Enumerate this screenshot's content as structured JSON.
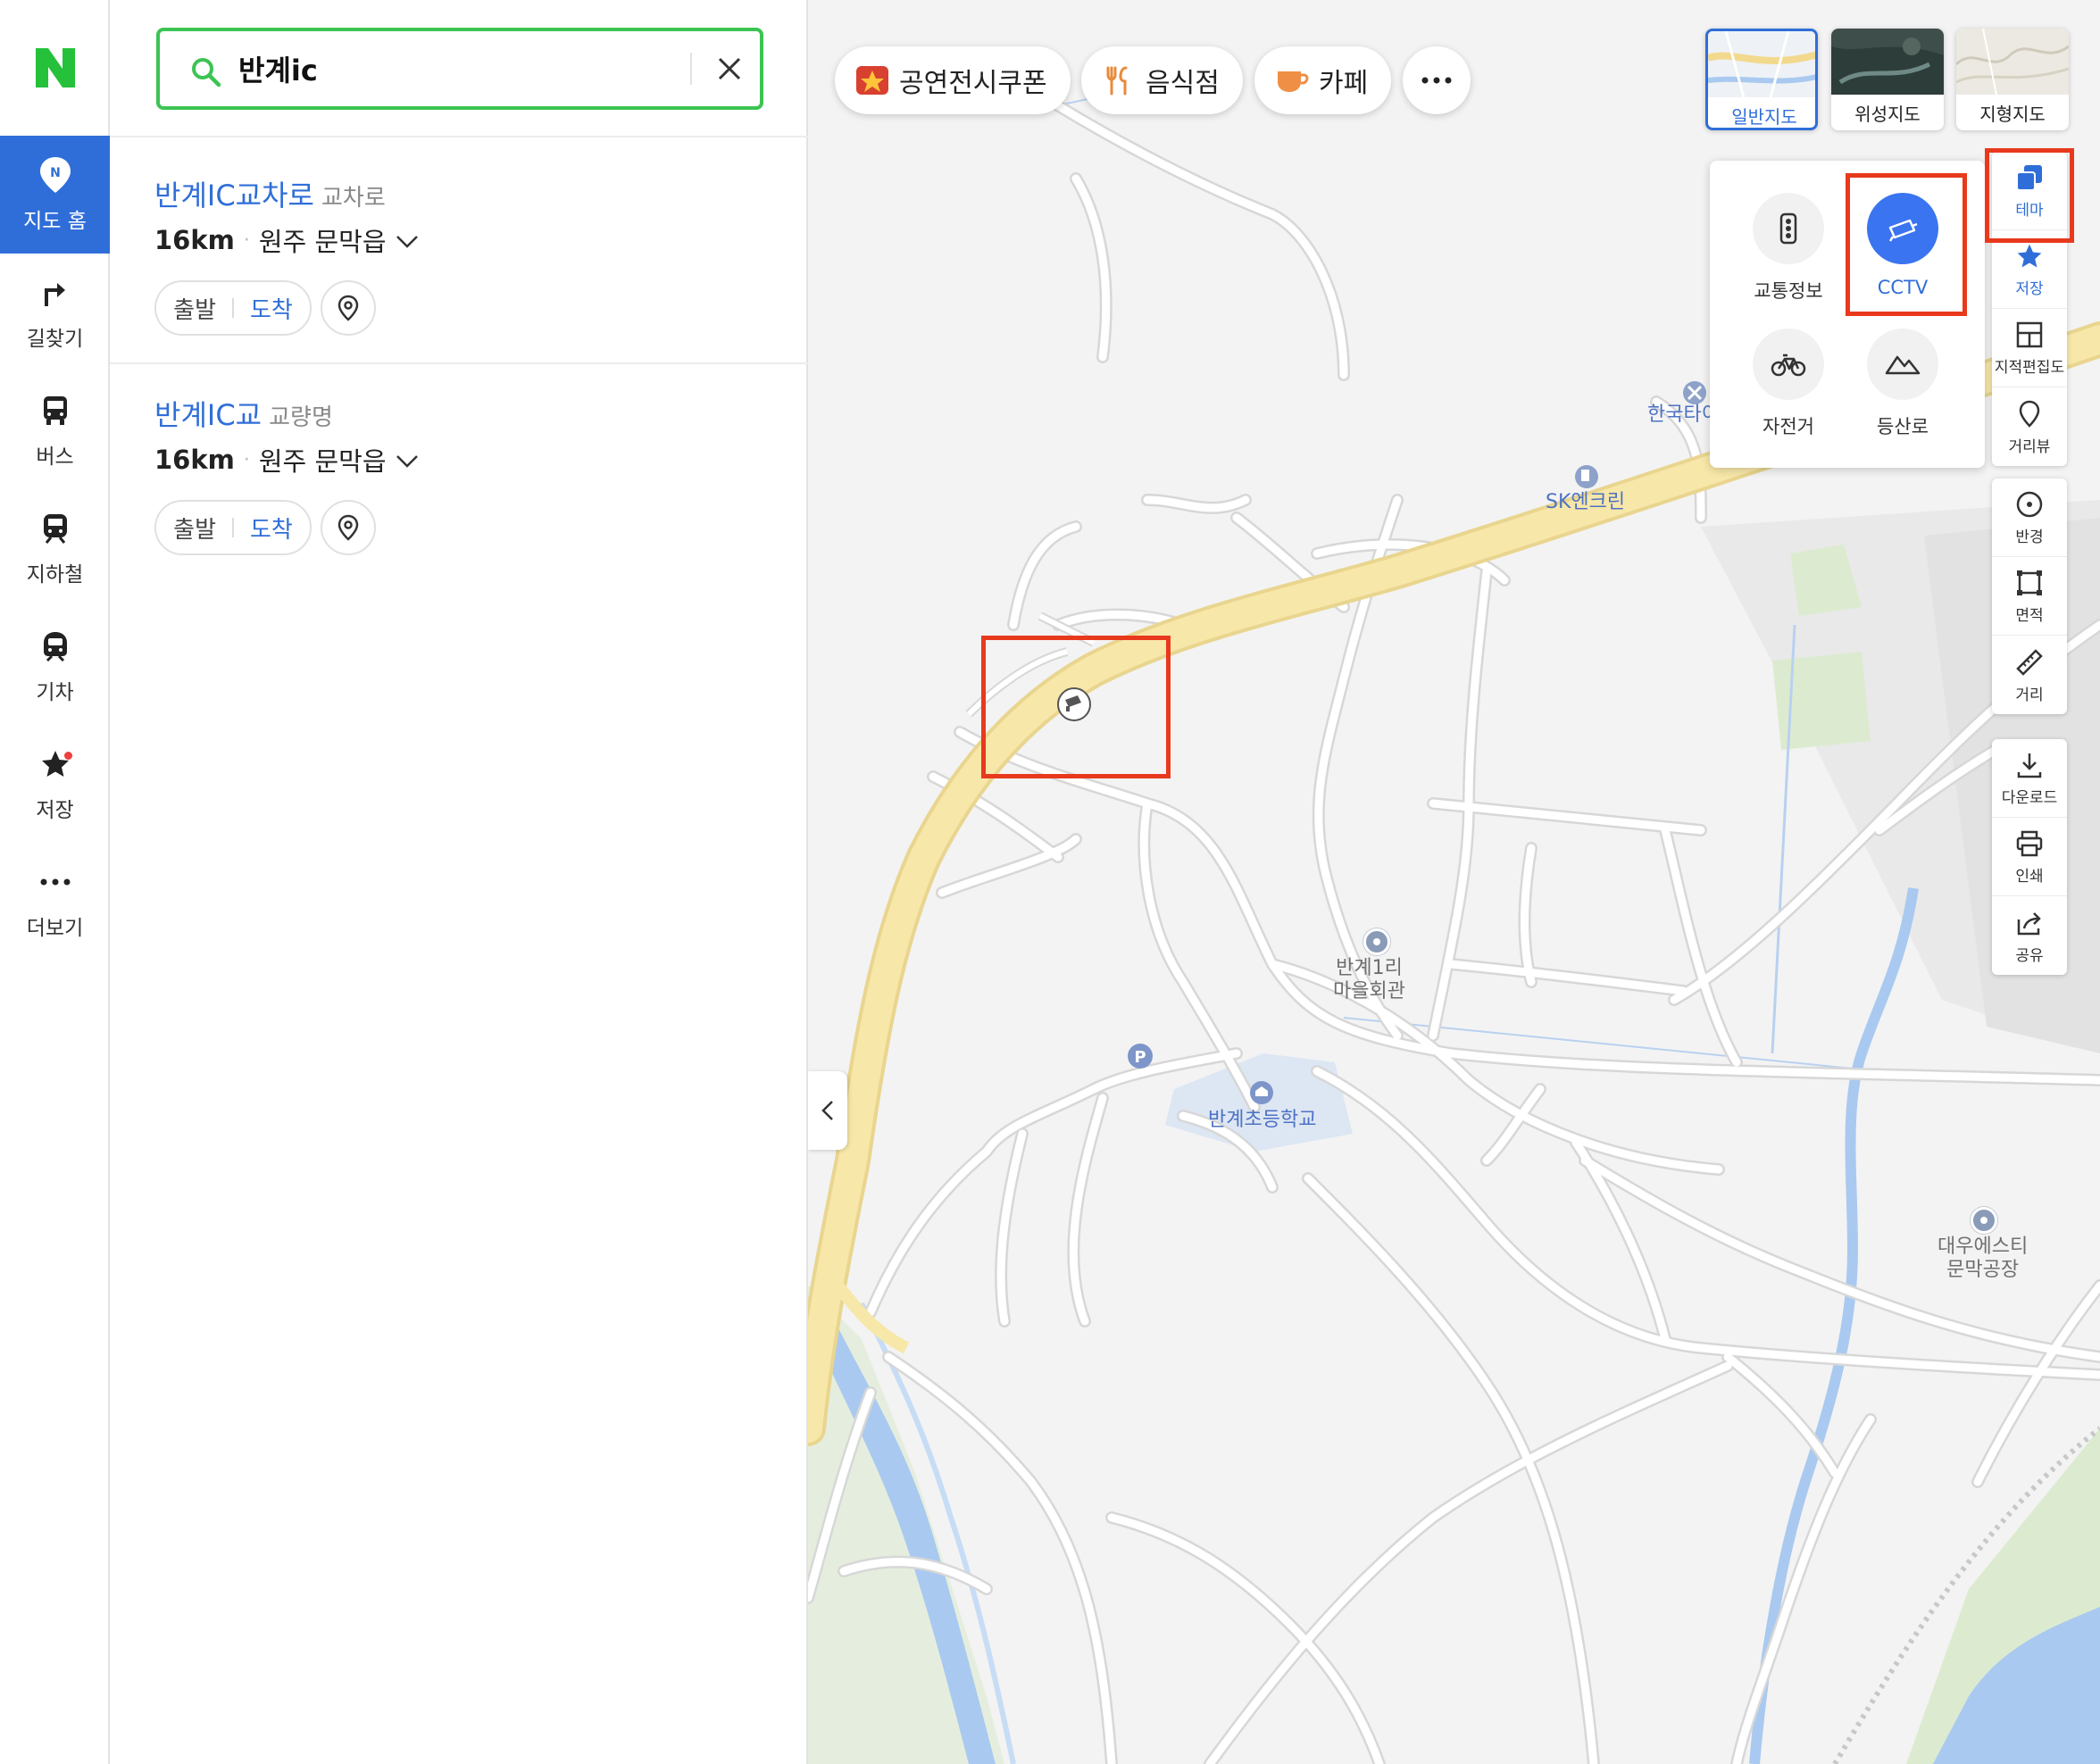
{
  "rail": {
    "items": [
      {
        "label": "지도 홈",
        "icon": "map-home-pin-icon",
        "active": true
      },
      {
        "label": "길찾기",
        "icon": "directions-arrow-icon"
      },
      {
        "label": "버스",
        "icon": "bus-icon"
      },
      {
        "label": "지하철",
        "icon": "subway-icon"
      },
      {
        "label": "기차",
        "icon": "train-icon"
      },
      {
        "label": "저장",
        "icon": "star-icon"
      },
      {
        "label": "더보기",
        "icon": "more-dots-icon"
      }
    ]
  },
  "search": {
    "query": "반계ic"
  },
  "results": [
    {
      "name": "반계IC교차로",
      "category": "교차로",
      "distance": "16km",
      "address": "원주 문막읍",
      "start_label": "출발",
      "arrive_label": "도착"
    },
    {
      "name": "반계IC교",
      "category": "교량명",
      "distance": "16km",
      "address": "원주 문막읍",
      "start_label": "출발",
      "arrive_label": "도착"
    }
  ],
  "map": {
    "chips": [
      {
        "label": "공연전시쿠폰",
        "icon": "ticket-coupon-icon"
      },
      {
        "label": "음식점",
        "icon": "fork-knife-icon"
      },
      {
        "label": "카페",
        "icon": "coffee-cup-icon"
      },
      {
        "label": "",
        "icon": "more-dots-icon"
      }
    ],
    "map_types": [
      {
        "label": "일반지도",
        "selected": true
      },
      {
        "label": "위성지도"
      },
      {
        "label": "지형지도"
      }
    ],
    "theme_items": [
      {
        "label": "교통정보",
        "icon": "traffic-light-icon"
      },
      {
        "label": "CCTV",
        "icon": "cctv-camera-icon",
        "active": true
      },
      {
        "label": "자전거",
        "icon": "bicycle-icon"
      },
      {
        "label": "등산로",
        "icon": "mountain-icon"
      }
    ],
    "tools_top": [
      {
        "label": "테마",
        "icon": "layers-icon",
        "active": true
      },
      {
        "label": "저장",
        "icon": "star-icon"
      },
      {
        "label": "지적편집도",
        "icon": "cadastral-grid-icon"
      },
      {
        "label": "거리뷰",
        "icon": "street-view-pin-icon"
      }
    ],
    "tools_measure": [
      {
        "label": "반경",
        "icon": "radius-icon"
      },
      {
        "label": "면적",
        "icon": "area-icon"
      },
      {
        "label": "거리",
        "icon": "ruler-icon"
      }
    ],
    "tools_export": [
      {
        "label": "다운로드",
        "icon": "download-icon"
      },
      {
        "label": "인쇄",
        "icon": "print-icon"
      },
      {
        "label": "공유",
        "icon": "share-icon"
      }
    ],
    "labels": {
      "hankook": "한국타이",
      "sk": "SK엔크린",
      "hall_line1": "반계1리",
      "hall_line2": "마을회관",
      "school": "반계초등학교",
      "factory_line1": "대우에스티",
      "factory_line2": "문막공장"
    },
    "colors": {
      "accent": "#2f6ed8",
      "highlight": "#e8391d",
      "search_border": "#3cc453",
      "road": "#f7e7a8",
      "water": "#a9c9f0"
    }
  }
}
